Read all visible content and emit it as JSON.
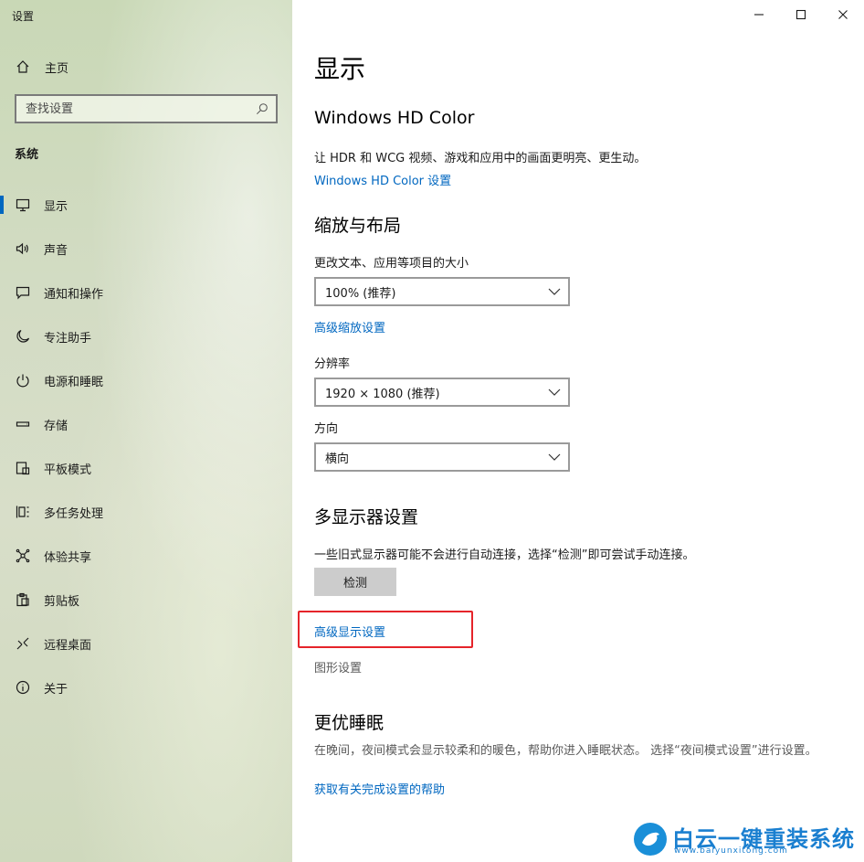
{
  "app": {
    "title": "设置"
  },
  "window_controls": {
    "minimize": "minimize-icon",
    "maximize": "maximize-icon",
    "close": "close-icon"
  },
  "sidebar": {
    "home_label": "主页",
    "search_placeholder": "查找设置",
    "section_label": "系统",
    "items": [
      {
        "label": "显示",
        "icon": "monitor-icon",
        "active": true
      },
      {
        "label": "声音",
        "icon": "speaker-icon"
      },
      {
        "label": "通知和操作",
        "icon": "notification-icon"
      },
      {
        "label": "专注助手",
        "icon": "moon-icon"
      },
      {
        "label": "电源和睡眠",
        "icon": "power-icon"
      },
      {
        "label": "存储",
        "icon": "storage-icon"
      },
      {
        "label": "平板模式",
        "icon": "tablet-icon"
      },
      {
        "label": "多任务处理",
        "icon": "multitask-icon"
      },
      {
        "label": "体验共享",
        "icon": "share-icon"
      },
      {
        "label": "剪贴板",
        "icon": "clipboard-icon"
      },
      {
        "label": "远程桌面",
        "icon": "remote-icon"
      },
      {
        "label": "关于",
        "icon": "info-icon"
      }
    ]
  },
  "main": {
    "title": "显示",
    "hdr": {
      "heading": "Windows HD Color",
      "description": "让 HDR 和 WCG 视频、游戏和应用中的画面更明亮、更生动。",
      "link": "Windows HD Color 设置"
    },
    "scale": {
      "heading": "缩放与布局",
      "size_label": "更改文本、应用等项目的大小",
      "size_value": "100% (推荐)",
      "advanced_link": "高级缩放设置",
      "resolution_label": "分辨率",
      "resolution_value": "1920 × 1080 (推荐)",
      "orientation_label": "方向",
      "orientation_value": "横向"
    },
    "multi": {
      "heading": "多显示器设置",
      "description": "一些旧式显示器可能不会进行自动连接，选择“检测”即可尝试手动连接。",
      "detect_button": "检测",
      "advanced_display_link": "高级显示设置",
      "graphics_settings": "图形设置"
    },
    "sleep": {
      "heading": "更优睡眠",
      "description": "在晚间，夜间模式会显示较柔和的暖色，帮助你进入睡眠状态。 选择“夜间模式设置”进行设置。",
      "help_link": "获取有关完成设置的帮助"
    }
  },
  "watermark": {
    "name": "白云一键重装系统",
    "url": "www.baiyunxitong.com"
  },
  "colors": {
    "accent": "#0067c0",
    "highlight": "#e5242a"
  }
}
